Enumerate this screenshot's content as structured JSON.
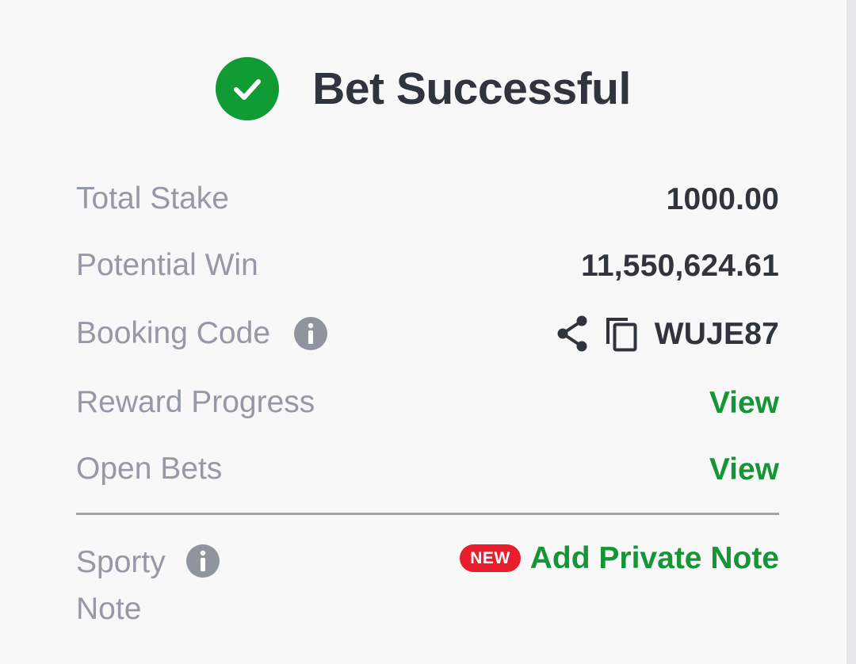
{
  "header": {
    "title": "Bet Successful",
    "icon": "check-circle-icon"
  },
  "summary": {
    "total_stake": {
      "label": "Total Stake",
      "value": "1000.00"
    },
    "potential_win": {
      "label": "Potential Win",
      "value": "11,550,624.61"
    },
    "booking_code": {
      "label": "Booking Code",
      "value": "WUJE87",
      "icons": [
        "info-icon",
        "share-icon",
        "copy-icon"
      ]
    },
    "reward_progress": {
      "label": "Reward Progress",
      "action": "View"
    },
    "open_bets": {
      "label": "Open Bets",
      "action": "View"
    }
  },
  "note": {
    "label": "Sporty Note",
    "badge": "NEW",
    "action": "Add Private Note"
  },
  "colors": {
    "accent_green": "#109b35",
    "text_dark": "#30343d",
    "text_muted": "#9499a5",
    "badge_red": "#e91e2c"
  }
}
